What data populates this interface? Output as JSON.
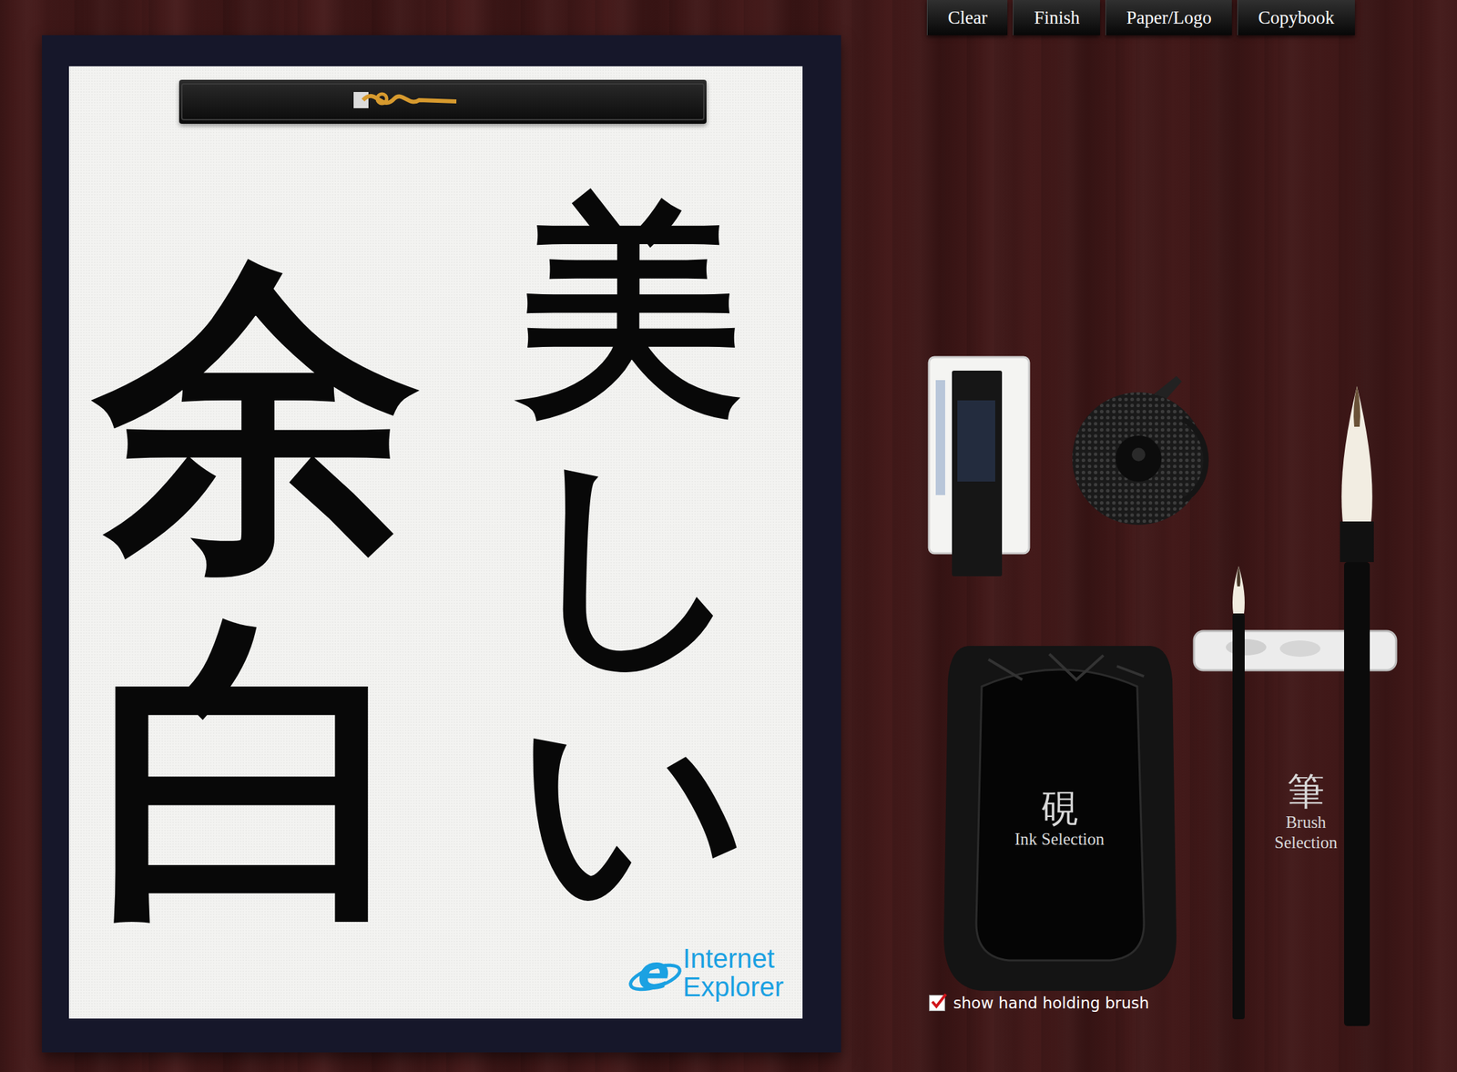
{
  "toolbar": [
    {
      "label": "Clear"
    },
    {
      "label": "Finish"
    },
    {
      "label": "Paper/Logo"
    },
    {
      "label": "Copybook"
    }
  ],
  "paper": {
    "columns": [
      "美しい",
      "余白"
    ],
    "logo": {
      "mark": "e",
      "line1": "Internet",
      "line2": "Explorer"
    }
  },
  "tools": {
    "ink": {
      "glyph": "硯",
      "label": "Ink Selection"
    },
    "brush": {
      "glyph": "筆",
      "label": "Brush Selection"
    }
  },
  "options": [
    {
      "label": "show hand holding brush",
      "checked": true
    }
  ]
}
